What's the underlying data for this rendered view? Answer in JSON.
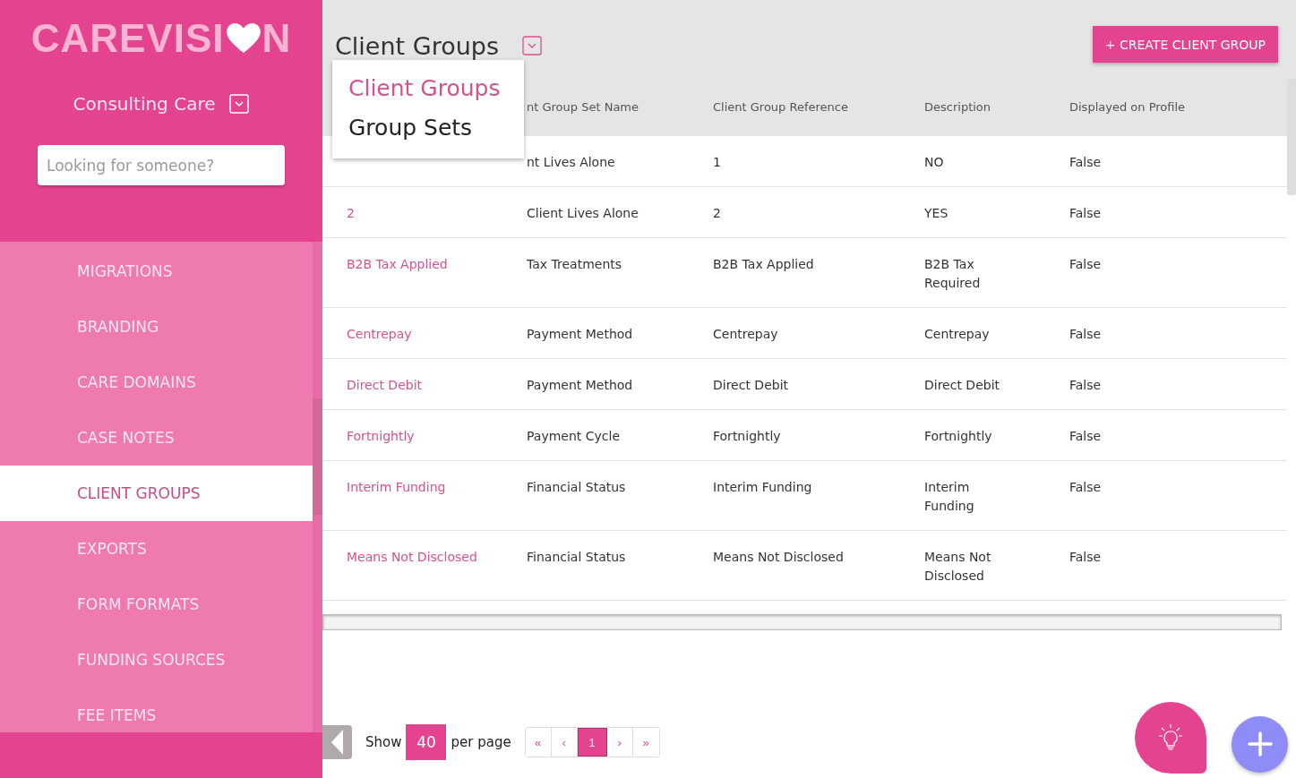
{
  "logo": {
    "text": "CAREVISI",
    "tail": "N"
  },
  "organisation": {
    "name": "Consulting Care"
  },
  "search": {
    "placeholder": "Looking for someone?"
  },
  "sidebar": {
    "items": [
      {
        "label": "MIGRATIONS",
        "selected": false
      },
      {
        "label": "BRANDING",
        "selected": false
      },
      {
        "label": "CARE DOMAINS",
        "selected": false
      },
      {
        "label": "CASE NOTES",
        "selected": false
      },
      {
        "label": "CLIENT GROUPS",
        "selected": true
      },
      {
        "label": "EXPORTS",
        "selected": false
      },
      {
        "label": "FORM FORMATS",
        "selected": false
      },
      {
        "label": "FUNDING SOURCES",
        "selected": false
      },
      {
        "label": "FEE ITEMS",
        "selected": false
      }
    ]
  },
  "page": {
    "title": "Client Groups",
    "create_button": "+ CREATE CLIENT GROUP"
  },
  "view_menu": {
    "items": [
      {
        "label": "Client Groups",
        "selected": true
      },
      {
        "label": "Group Sets",
        "selected": false
      }
    ]
  },
  "table": {
    "columns": [
      "nt Group Set Name",
      "Client Group Reference",
      "Description",
      "Displayed on Profile"
    ],
    "rows": [
      {
        "cells": [
          "nt Lives Alone",
          "1",
          "NO",
          "False"
        ]
      },
      {
        "name": "2",
        "cells": [
          "Client Lives Alone",
          "2",
          "YES",
          "False"
        ]
      },
      {
        "name": "B2B Tax Applied",
        "cells": [
          "Tax Treatments",
          "B2B Tax Applied",
          "B2B Tax Required",
          "False"
        ]
      },
      {
        "name": "Centrepay",
        "cells": [
          "Payment Method",
          "Centrepay",
          "Centrepay",
          "False"
        ]
      },
      {
        "name": "Direct Debit",
        "cells": [
          "Payment Method",
          "Direct Debit",
          "Direct Debit",
          "False"
        ]
      },
      {
        "name": "Fortnightly",
        "cells": [
          "Payment Cycle",
          "Fortnightly",
          "Fortnightly",
          "False"
        ]
      },
      {
        "name": "Interim Funding",
        "cells": [
          "Financial Status",
          "Interim Funding",
          "Interim Funding",
          "False"
        ]
      },
      {
        "name": "Means Not Disclosed",
        "cells": [
          "Financial Status",
          "Means Not Disclosed",
          "Means Not Disclosed",
          "False"
        ]
      }
    ]
  },
  "pagination": {
    "show": "Show",
    "per_page_value": "40",
    "per_page": "per page",
    "pages": [
      {
        "label": "«",
        "selected": false
      },
      {
        "label": "‹",
        "selected": false
      },
      {
        "label": "1",
        "selected": true
      },
      {
        "label": "›",
        "selected": false
      },
      {
        "label": "»",
        "selected": false
      }
    ]
  }
}
